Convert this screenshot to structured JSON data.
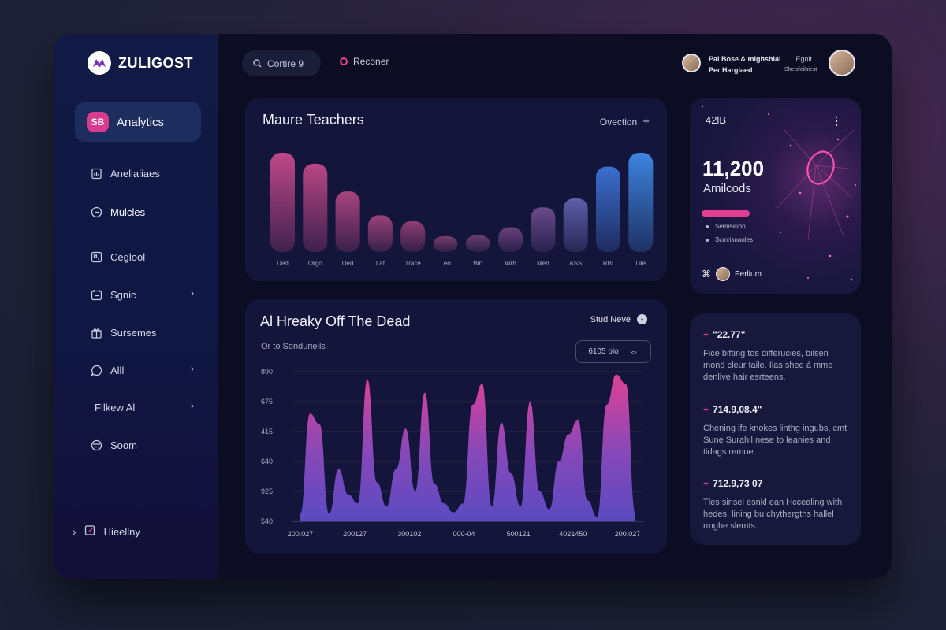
{
  "brand": {
    "name": "ZULIGOST"
  },
  "sidebar": {
    "active": {
      "badge": "SB",
      "label": "Analytics"
    },
    "items": [
      {
        "label": "Anelialiaes",
        "icon": "document-chart-icon",
        "chevron": false
      },
      {
        "label": "Mulcles",
        "icon": "clock-icon",
        "chevron": false
      },
      {
        "label": "Ceglool",
        "icon": "grid-icon",
        "chevron": false
      },
      {
        "label": "Sgnic",
        "icon": "calendar-icon",
        "chevron": true
      },
      {
        "label": "Sursemes",
        "icon": "gift-icon",
        "chevron": false
      },
      {
        "label": "Alll",
        "icon": "chat-bubble-icon",
        "chevron": true
      },
      {
        "label": "Fllkew Al",
        "icon": "",
        "chevron": true
      },
      {
        "label": "Soom",
        "icon": "globe-icon",
        "chevron": false
      }
    ],
    "help": {
      "label": "Hieellny",
      "icon": "edit-icon"
    }
  },
  "topbar": {
    "search_label": "Cortire 9",
    "link_label": "Reconer",
    "user_name_line1": "Pal Bose & mighshial",
    "user_name_line2": "Per Harglaed",
    "user_meta_line1": "Egnit",
    "user_meta_line2": "Shetsfeilsiest"
  },
  "bar_card": {
    "title": "Maure Teachers",
    "option_label": "Ovection",
    "option_icon": "plus-icon"
  },
  "area_card": {
    "title": "Al Hreaky Off The Dead",
    "subtitle": "Or to Sondurieils",
    "stud_label": "Stud Neve",
    "range_label": "6105 olo",
    "range_icon": "arrows-icon"
  },
  "stat_card": {
    "top_label": "42lB",
    "menu": "⋮",
    "number": "11,200",
    "label": "Amilcods",
    "progress": 0.35,
    "list": [
      "Semisicion",
      "Scmrisnanles"
    ],
    "footer": "Perlium"
  },
  "notes": [
    {
      "value": "\"22.77\"",
      "text": "Fice bifting tos differucies, bilsen mond cleur taile. Ilas shed á mme denlive hair esrteens."
    },
    {
      "value": "714.9,08.4\"",
      "text": "Chening ife knokes linthg ingubs, cmt Sune Surahil nese to leanies and tidags remoe."
    },
    {
      "value": "712.9,73 07",
      "text": "Tles sinsel esnkl ean Hccealing with hedes, lining bu chythergths hallel rmghe slemts."
    }
  ],
  "chart_data": [
    {
      "type": "bar",
      "title": "Maure Teachers",
      "categories": [
        "Ded",
        "Orgo",
        "Ded",
        "Laf",
        "Trace",
        "Leo",
        "Wrt",
        "Wrh",
        "Med",
        "ASS",
        "RBI",
        "Lile"
      ],
      "values": [
        100,
        89,
        61,
        37,
        31,
        16,
        17,
        25,
        45,
        54,
        86,
        100
      ],
      "colors": [
        "#c04888",
        "#b94684",
        "#a8447e",
        "#9a4278",
        "#8e3e72",
        "#7a3c6a",
        "#6b3c70",
        "#6a407c",
        "#6a4a8a",
        "#5d5ea8",
        "#3a6ed0",
        "#3d84e0"
      ],
      "ylim": [
        0,
        100
      ]
    },
    {
      "type": "area",
      "title": "Al Hreaky Off The Dead",
      "yticks": [
        "540",
        "925",
        "640",
        "415",
        "675",
        "890"
      ],
      "xticks": [
        "200.027",
        "200127",
        "300102",
        "000-04",
        "500121",
        "4021450",
        "200.027"
      ],
      "values": [
        5,
        72,
        65,
        5,
        35,
        18,
        12,
        95,
        26,
        10,
        35,
        62,
        20,
        86,
        25,
        12,
        6,
        12,
        78,
        92,
        10,
        66,
        32,
        10,
        80,
        20,
        8,
        40,
        58,
        68,
        14,
        3,
        78,
        98,
        92,
        5
      ],
      "ylim": [
        0,
        100
      ]
    }
  ],
  "colors": {
    "accent": "#e13f93",
    "blue": "#3d84e0",
    "background": "#0c0d22",
    "sidebar": "#101a44"
  }
}
